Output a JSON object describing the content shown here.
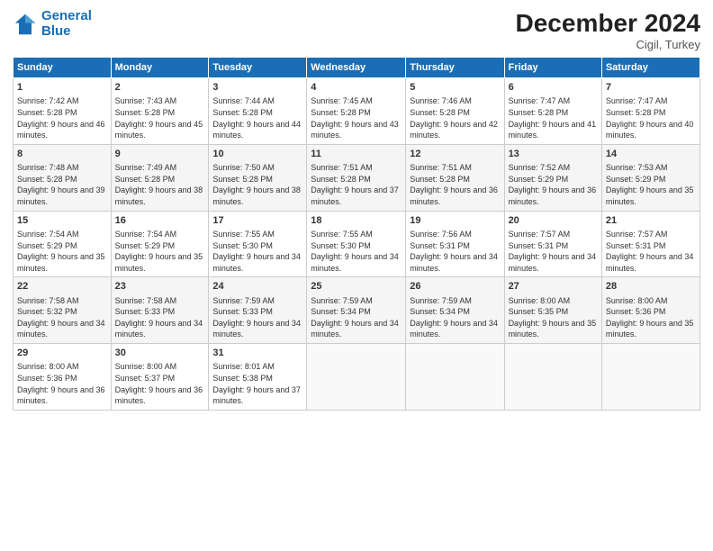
{
  "header": {
    "logo_line1": "General",
    "logo_line2": "Blue",
    "title": "December 2024",
    "subtitle": "Cigil, Turkey"
  },
  "days_of_week": [
    "Sunday",
    "Monday",
    "Tuesday",
    "Wednesday",
    "Thursday",
    "Friday",
    "Saturday"
  ],
  "weeks": [
    [
      {
        "day": 1,
        "sunrise": "7:42 AM",
        "sunset": "5:28 PM",
        "daylight": "9 hours and 46 minutes."
      },
      {
        "day": 2,
        "sunrise": "7:43 AM",
        "sunset": "5:28 PM",
        "daylight": "9 hours and 45 minutes."
      },
      {
        "day": 3,
        "sunrise": "7:44 AM",
        "sunset": "5:28 PM",
        "daylight": "9 hours and 44 minutes."
      },
      {
        "day": 4,
        "sunrise": "7:45 AM",
        "sunset": "5:28 PM",
        "daylight": "9 hours and 43 minutes."
      },
      {
        "day": 5,
        "sunrise": "7:46 AM",
        "sunset": "5:28 PM",
        "daylight": "9 hours and 42 minutes."
      },
      {
        "day": 6,
        "sunrise": "7:47 AM",
        "sunset": "5:28 PM",
        "daylight": "9 hours and 41 minutes."
      },
      {
        "day": 7,
        "sunrise": "7:47 AM",
        "sunset": "5:28 PM",
        "daylight": "9 hours and 40 minutes."
      }
    ],
    [
      {
        "day": 8,
        "sunrise": "7:48 AM",
        "sunset": "5:28 PM",
        "daylight": "9 hours and 39 minutes."
      },
      {
        "day": 9,
        "sunrise": "7:49 AM",
        "sunset": "5:28 PM",
        "daylight": "9 hours and 38 minutes."
      },
      {
        "day": 10,
        "sunrise": "7:50 AM",
        "sunset": "5:28 PM",
        "daylight": "9 hours and 38 minutes."
      },
      {
        "day": 11,
        "sunrise": "7:51 AM",
        "sunset": "5:28 PM",
        "daylight": "9 hours and 37 minutes."
      },
      {
        "day": 12,
        "sunrise": "7:51 AM",
        "sunset": "5:28 PM",
        "daylight": "9 hours and 36 minutes."
      },
      {
        "day": 13,
        "sunrise": "7:52 AM",
        "sunset": "5:29 PM",
        "daylight": "9 hours and 36 minutes."
      },
      {
        "day": 14,
        "sunrise": "7:53 AM",
        "sunset": "5:29 PM",
        "daylight": "9 hours and 35 minutes."
      }
    ],
    [
      {
        "day": 15,
        "sunrise": "7:54 AM",
        "sunset": "5:29 PM",
        "daylight": "9 hours and 35 minutes."
      },
      {
        "day": 16,
        "sunrise": "7:54 AM",
        "sunset": "5:29 PM",
        "daylight": "9 hours and 35 minutes."
      },
      {
        "day": 17,
        "sunrise": "7:55 AM",
        "sunset": "5:30 PM",
        "daylight": "9 hours and 34 minutes."
      },
      {
        "day": 18,
        "sunrise": "7:55 AM",
        "sunset": "5:30 PM",
        "daylight": "9 hours and 34 minutes."
      },
      {
        "day": 19,
        "sunrise": "7:56 AM",
        "sunset": "5:31 PM",
        "daylight": "9 hours and 34 minutes."
      },
      {
        "day": 20,
        "sunrise": "7:57 AM",
        "sunset": "5:31 PM",
        "daylight": "9 hours and 34 minutes."
      },
      {
        "day": 21,
        "sunrise": "7:57 AM",
        "sunset": "5:31 PM",
        "daylight": "9 hours and 34 minutes."
      }
    ],
    [
      {
        "day": 22,
        "sunrise": "7:58 AM",
        "sunset": "5:32 PM",
        "daylight": "9 hours and 34 minutes."
      },
      {
        "day": 23,
        "sunrise": "7:58 AM",
        "sunset": "5:33 PM",
        "daylight": "9 hours and 34 minutes."
      },
      {
        "day": 24,
        "sunrise": "7:59 AM",
        "sunset": "5:33 PM",
        "daylight": "9 hours and 34 minutes."
      },
      {
        "day": 25,
        "sunrise": "7:59 AM",
        "sunset": "5:34 PM",
        "daylight": "9 hours and 34 minutes."
      },
      {
        "day": 26,
        "sunrise": "7:59 AM",
        "sunset": "5:34 PM",
        "daylight": "9 hours and 34 minutes."
      },
      {
        "day": 27,
        "sunrise": "8:00 AM",
        "sunset": "5:35 PM",
        "daylight": "9 hours and 35 minutes."
      },
      {
        "day": 28,
        "sunrise": "8:00 AM",
        "sunset": "5:36 PM",
        "daylight": "9 hours and 35 minutes."
      }
    ],
    [
      {
        "day": 29,
        "sunrise": "8:00 AM",
        "sunset": "5:36 PM",
        "daylight": "9 hours and 36 minutes."
      },
      {
        "day": 30,
        "sunrise": "8:00 AM",
        "sunset": "5:37 PM",
        "daylight": "9 hours and 36 minutes."
      },
      {
        "day": 31,
        "sunrise": "8:01 AM",
        "sunset": "5:38 PM",
        "daylight": "9 hours and 37 minutes."
      },
      null,
      null,
      null,
      null
    ]
  ]
}
